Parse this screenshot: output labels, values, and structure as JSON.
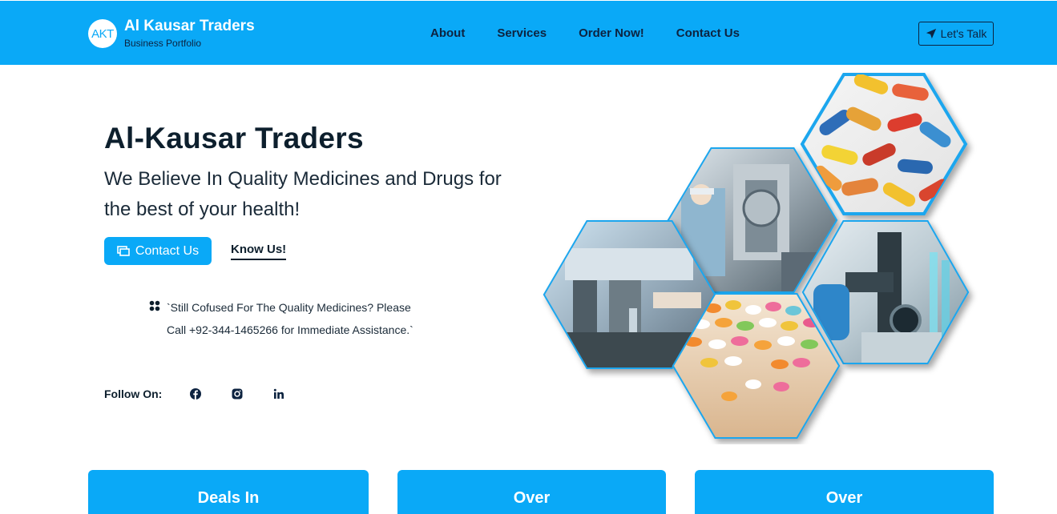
{
  "brand": {
    "logo_text": "AKT",
    "name": "Al Kausar Traders",
    "subtitle": "Business Portfolio"
  },
  "nav": {
    "links": [
      "About",
      "Services",
      "Order Now!",
      "Contact Us"
    ],
    "cta_label": "Let's Talk"
  },
  "hero": {
    "title": "Al-Kausar Traders",
    "subtitle": "We Believe In Quality Medicines and Drugs for the best of your health!",
    "contact_button": "Contact Us",
    "know_link": "Know Us!",
    "assist_line1": "`Still Cofused For The Quality Medicines? Please",
    "assist_line2": "Call +92-344-1465266 for Immediate Assistance.`",
    "follow_label": "Follow On:"
  },
  "social": [
    "facebook-icon",
    "instagram-icon",
    "linkedin-icon"
  ],
  "cards": [
    "Deals In",
    "Over",
    "Over"
  ],
  "colors": {
    "primary": "#0aa9f7",
    "dark": "#0d2340",
    "text": "#0d1f2d"
  }
}
